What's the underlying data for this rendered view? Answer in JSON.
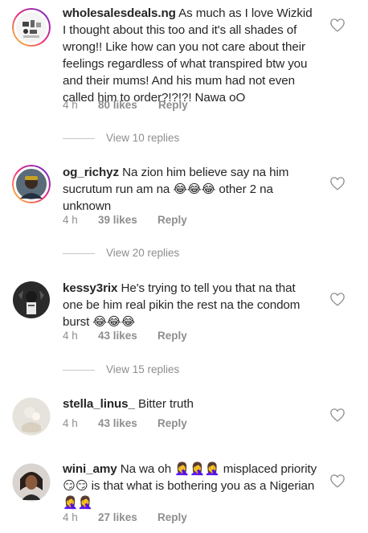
{
  "comments": [
    {
      "username": "wholesalesdeals.ng",
      "text": " As much as I love Wizkid I thought about this too and it's all shades of wrong!! Like how can you not care about their feelings regardless of what transpired btw you and their mums! And his mum had not even called him to order?!?!?! Nawa oO",
      "time": "4 h",
      "likes": "80 likes",
      "reply": "Reply",
      "view_replies": "View 10 replies"
    },
    {
      "username": "og_richyz",
      "text": " Na zion him believe say na him sucrutum run am na 😂😂😂 other 2 na unknown",
      "time": "4 h",
      "likes": "39 likes",
      "reply": "Reply",
      "view_replies": "View 20 replies"
    },
    {
      "username": "kessy3rix",
      "text": " He's trying to tell you that na that one be him real pikin the rest na the condom burst 😂😂😂",
      "time": "4 h",
      "likes": "43 likes",
      "reply": "Reply",
      "view_replies": "View 15 replies"
    },
    {
      "username": "stella_linus_",
      "text": " Bitter truth",
      "time": "4 h",
      "likes": "43 likes",
      "reply": "Reply",
      "view_replies": ""
    },
    {
      "username": "wini_amy",
      "text": " Na wa oh 🤦‍♀️🤦‍♀️🤦‍♀️ misplaced priority 😏😏 is that what is bothering you as a Nigerian 🤦‍♀️🤦‍♀️",
      "time": "4 h",
      "likes": "27 likes",
      "reply": "Reply",
      "view_replies": ""
    }
  ],
  "icons": {
    "like": "heart-outline-icon",
    "avatar_ring_color": "#d6249f"
  }
}
